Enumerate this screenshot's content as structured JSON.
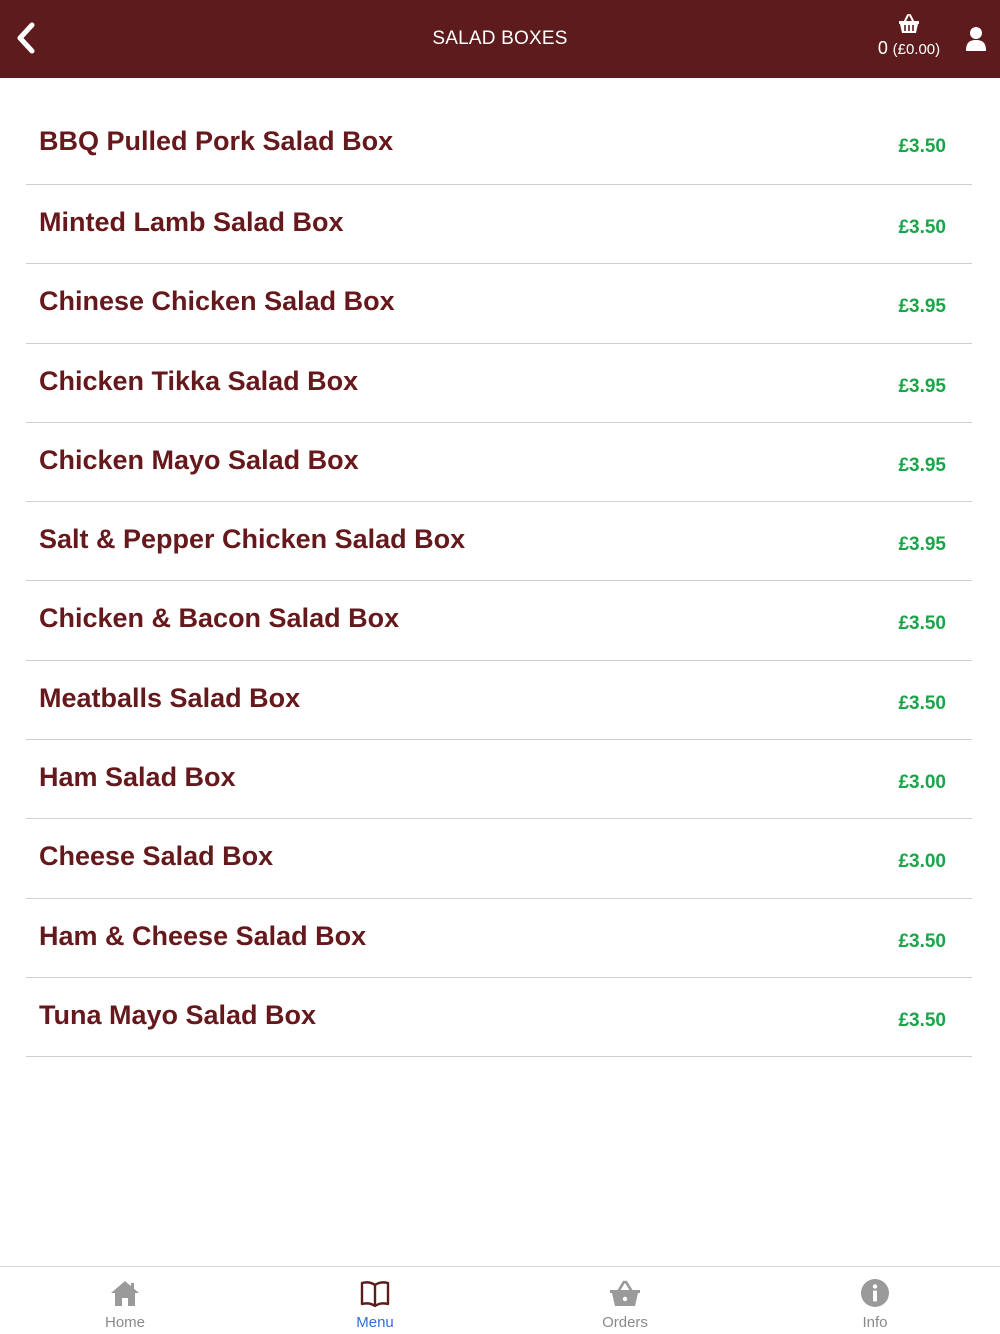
{
  "header": {
    "title": "SALAD BOXES",
    "basket": {
      "count": "0",
      "total": "(£0.00)"
    }
  },
  "colors": {
    "header_bg": "#5e1b1d",
    "item_name": "#66191c",
    "price": "#1aa54a",
    "tab_active": "#2f6fe0",
    "tab_inactive": "#8a8a8a"
  },
  "icons": {
    "back": "chevron-left-icon",
    "basket": "basket-icon",
    "user": "user-icon",
    "home": "home-icon",
    "menu": "book-icon",
    "orders": "basket-icon",
    "info": "info-icon"
  },
  "menu": {
    "items": [
      {
        "name": "BBQ Pulled Pork Salad Box",
        "price": "£3.50"
      },
      {
        "name": "Minted Lamb Salad Box",
        "price": "£3.50"
      },
      {
        "name": "Chinese Chicken Salad Box",
        "price": "£3.95"
      },
      {
        "name": "Chicken Tikka Salad Box",
        "price": "£3.95"
      },
      {
        "name": "Chicken Mayo Salad Box",
        "price": "£3.95"
      },
      {
        "name": "Salt & Pepper Chicken Salad Box",
        "price": "£3.95"
      },
      {
        "name": "Chicken & Bacon Salad Box",
        "price": "£3.50"
      },
      {
        "name": "Meatballs Salad Box",
        "price": "£3.50"
      },
      {
        "name": "Ham Salad Box",
        "price": "£3.00"
      },
      {
        "name": "Cheese Salad Box",
        "price": "£3.00"
      },
      {
        "name": "Ham & Cheese Salad Box",
        "price": "£3.50"
      },
      {
        "name": "Tuna Mayo Salad Box",
        "price": "£3.50"
      }
    ]
  },
  "tabbar": {
    "tabs": [
      {
        "label": "Home",
        "active": false
      },
      {
        "label": "Menu",
        "active": true
      },
      {
        "label": "Orders",
        "active": false
      },
      {
        "label": "Info",
        "active": false
      }
    ]
  }
}
